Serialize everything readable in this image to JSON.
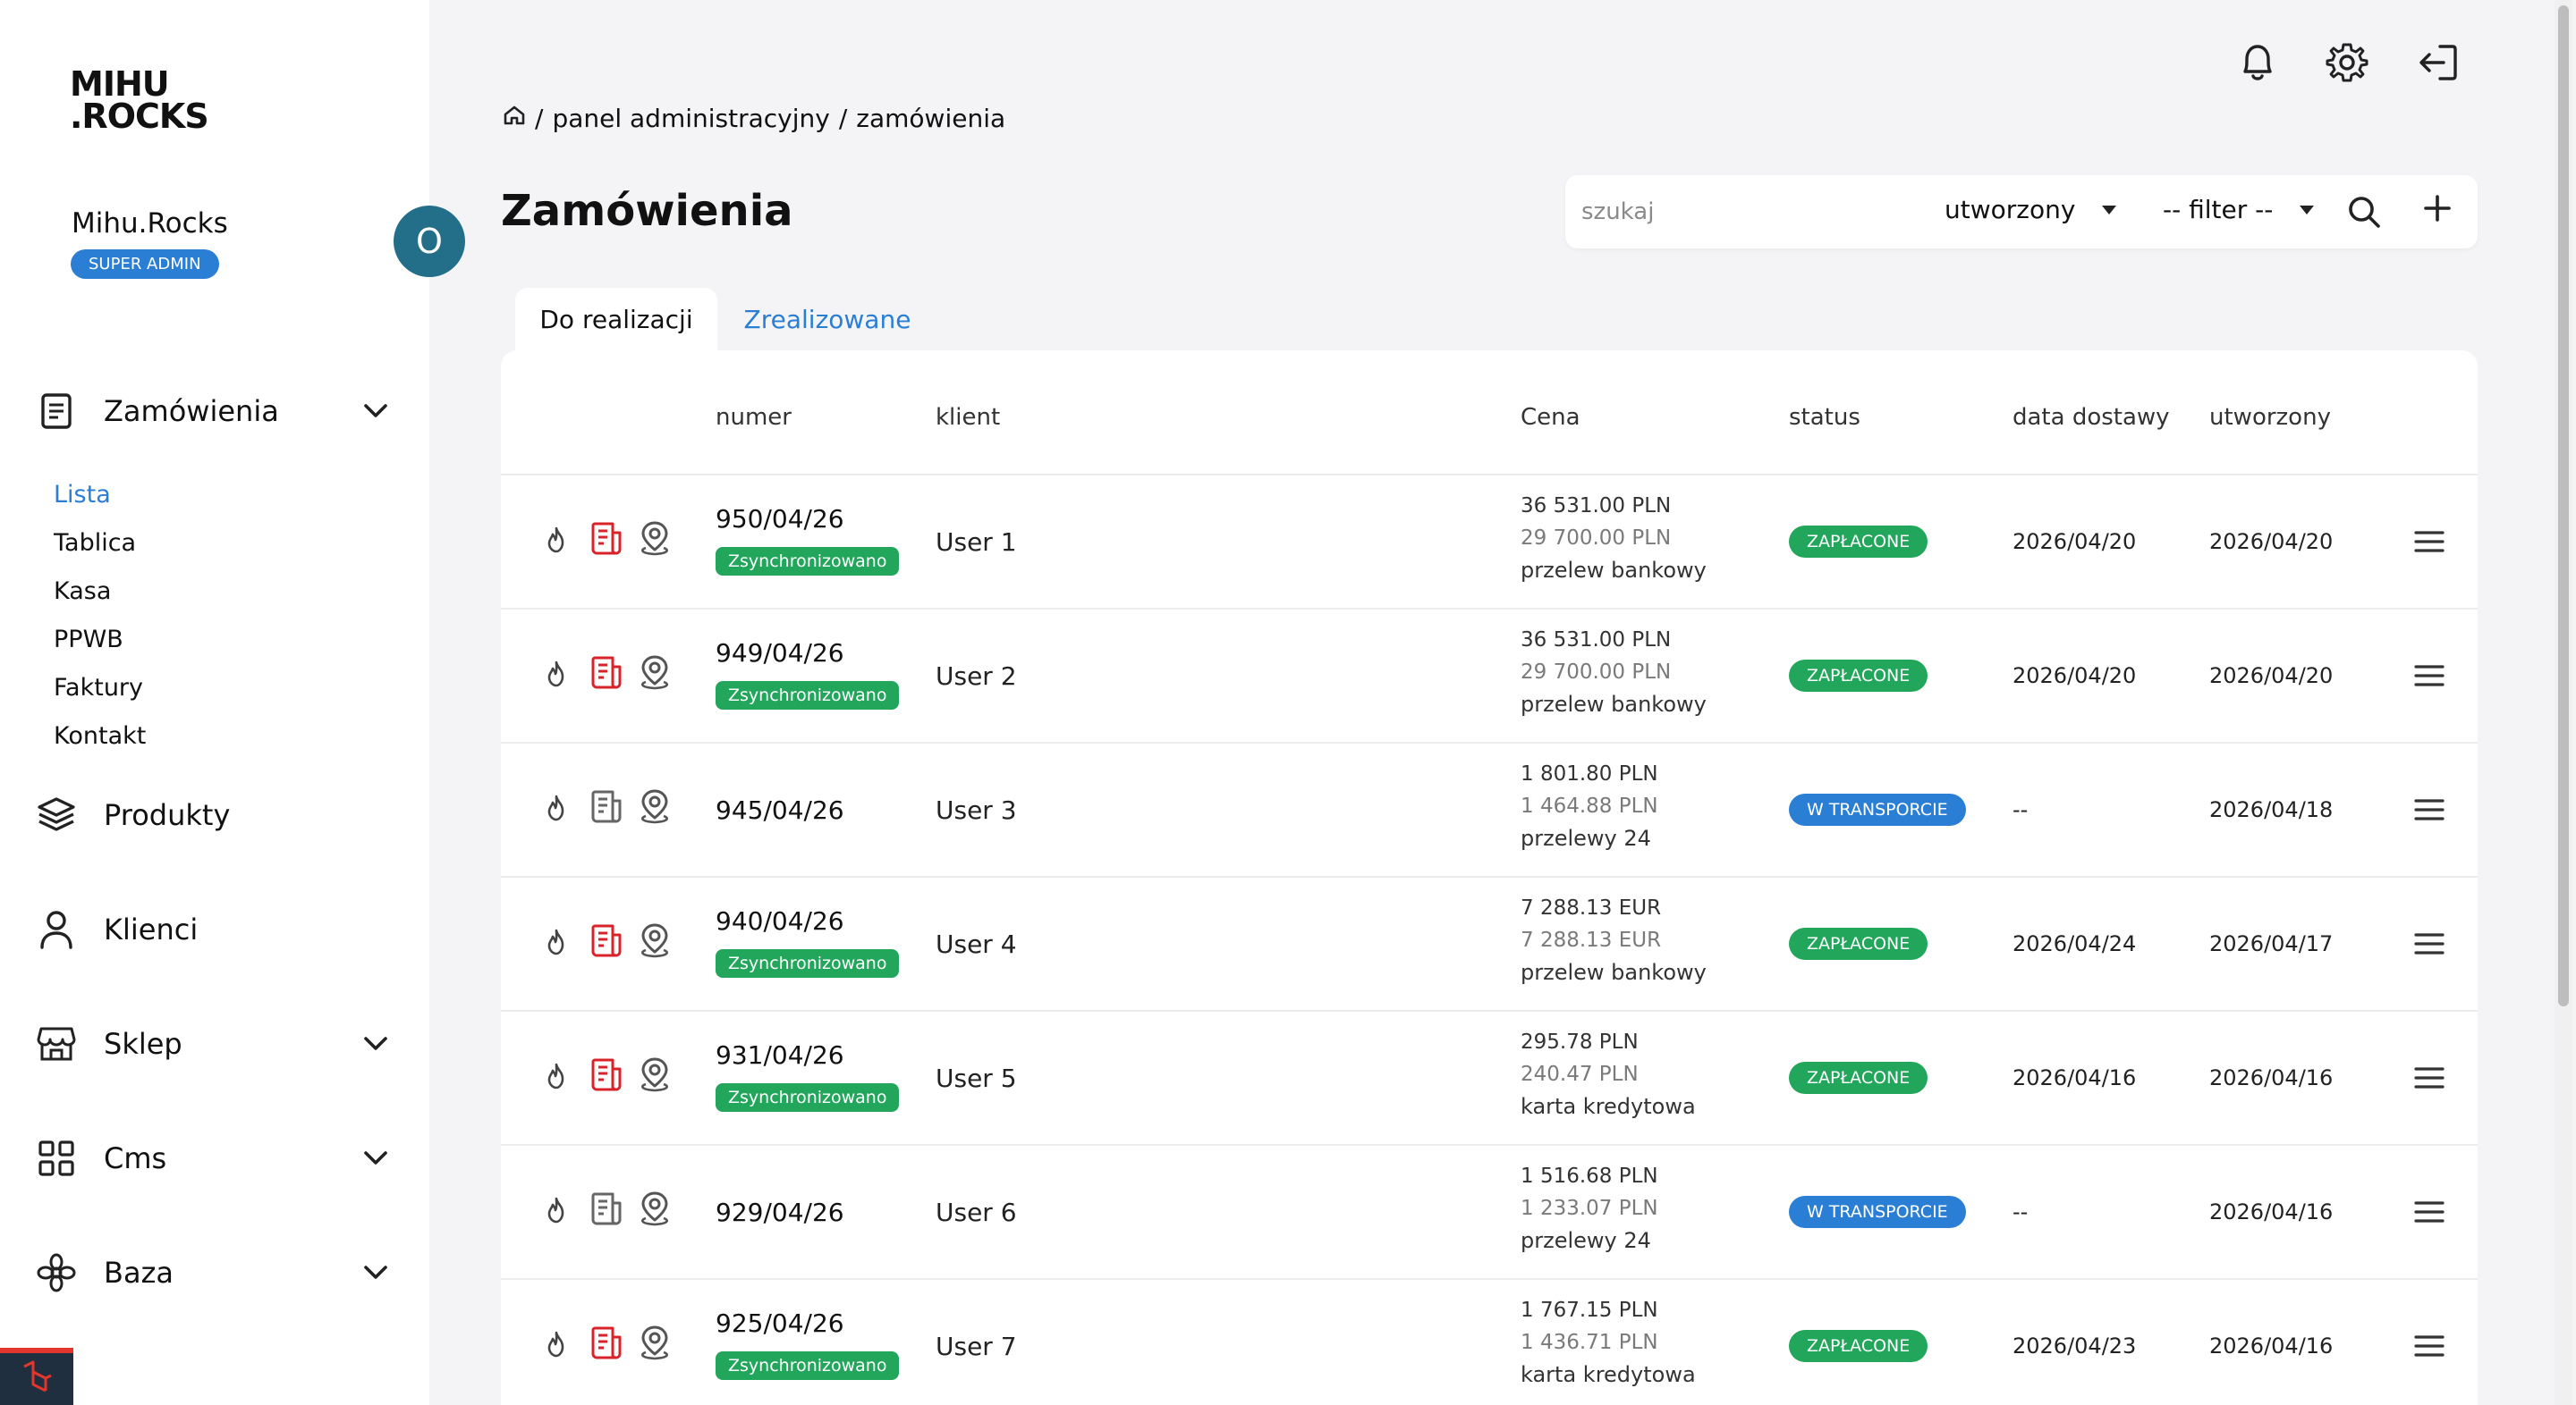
{
  "sidebar": {
    "logo": "MIHU\n.ROCKS",
    "user_name": "Mihu.Rocks",
    "role": "SUPER ADMIN",
    "avatar_letter": "O",
    "nav": [
      {
        "label": "Zamówienia",
        "icon": "document-icon",
        "expandable": true
      },
      {
        "label": "Produkty",
        "icon": "layers-icon",
        "expandable": false
      },
      {
        "label": "Klienci",
        "icon": "user-icon",
        "expandable": false
      },
      {
        "label": "Sklep",
        "icon": "store-icon",
        "expandable": true
      },
      {
        "label": "Cms",
        "icon": "grid-icon",
        "expandable": true
      },
      {
        "label": "Baza",
        "icon": "flower-icon",
        "expandable": true
      }
    ],
    "sub_items": [
      "Lista",
      "Tablica",
      "Kasa",
      "PPWB",
      "Faktury",
      "Kontakt"
    ]
  },
  "header": {
    "breadcrumb": [
      "panel administracyjny",
      "zamówienia"
    ],
    "title": "Zamówienia"
  },
  "toolbar": {
    "search_placeholder": "szukaj",
    "sort_value": "utworzony",
    "filter_value": "-- filter --"
  },
  "tabs": [
    {
      "label": "Do realizacji",
      "active": true
    },
    {
      "label": "Zrealizowane",
      "active": false
    }
  ],
  "table": {
    "columns": [
      "numer",
      "klient",
      "Cena",
      "status",
      "data dostawy",
      "utworzony"
    ],
    "rows": [
      {
        "number": "950/04/26",
        "sync": "Zsynchronizowano",
        "client": "User 1",
        "price_gross": "36 531.00 PLN",
        "price_net": "29 700.00 PLN",
        "payment": "przelew bankowy",
        "status": "ZAPŁACONE",
        "status_type": "paid",
        "delivery": "2026/04/20",
        "created": "2026/04/20",
        "invoice_color": "#d8232a"
      },
      {
        "number": "949/04/26",
        "sync": "Zsynchronizowano",
        "client": "User 2",
        "price_gross": "36 531.00 PLN",
        "price_net": "29 700.00 PLN",
        "payment": "przelew bankowy",
        "status": "ZAPŁACONE",
        "status_type": "paid",
        "delivery": "2026/04/20",
        "created": "2026/04/20",
        "invoice_color": "#d8232a"
      },
      {
        "number": "945/04/26",
        "sync": "",
        "client": "User 3",
        "price_gross": "1 801.80 PLN",
        "price_net": "1 464.88 PLN",
        "payment": "przelewy 24",
        "status": "W TRANSPORCIE",
        "status_type": "transit",
        "delivery": "--",
        "created": "2026/04/18",
        "invoice_color": "#666666"
      },
      {
        "number": "940/04/26",
        "sync": "Zsynchronizowano",
        "client": "User 4",
        "price_gross": "7 288.13 EUR",
        "price_net": "7 288.13 EUR",
        "payment": "przelew bankowy",
        "status": "ZAPŁACONE",
        "status_type": "paid",
        "delivery": "2026/04/24",
        "created": "2026/04/17",
        "invoice_color": "#d8232a"
      },
      {
        "number": "931/04/26",
        "sync": "Zsynchronizowano",
        "client": "User 5",
        "price_gross": "295.78 PLN",
        "price_net": "240.47 PLN",
        "payment": "karta kredytowa",
        "status": "ZAPŁACONE",
        "status_type": "paid",
        "delivery": "2026/04/16",
        "created": "2026/04/16",
        "invoice_color": "#d8232a"
      },
      {
        "number": "929/04/26",
        "sync": "",
        "client": "User 6",
        "price_gross": "1 516.68 PLN",
        "price_net": "1 233.07 PLN",
        "payment": "przelewy 24",
        "status": "W TRANSPORCIE",
        "status_type": "transit",
        "delivery": "--",
        "created": "2026/04/16",
        "invoice_color": "#666666"
      },
      {
        "number": "925/04/26",
        "sync": "Zsynchronizowano",
        "client": "User 7",
        "price_gross": "1 767.15 PLN",
        "price_net": "1 436.71 PLN",
        "payment": "karta kredytowa",
        "status": "ZAPŁACONE",
        "status_type": "paid",
        "delivery": "2026/04/23",
        "created": "2026/04/16",
        "invoice_color": "#d8232a"
      }
    ]
  },
  "colors": {
    "accent": "#2a7fd4",
    "paid": "#21a65b",
    "avatar": "#236f89",
    "invoice_red": "#d8232a"
  },
  "icons": {
    "top_bar": [
      "bell-icon",
      "gear-icon",
      "logout-icon"
    ],
    "toolbar": [
      "search-icon",
      "plus-icon"
    ],
    "row": [
      "flame-icon",
      "invoice-icon",
      "location-icon",
      "hamburger-menu-icon"
    ]
  }
}
